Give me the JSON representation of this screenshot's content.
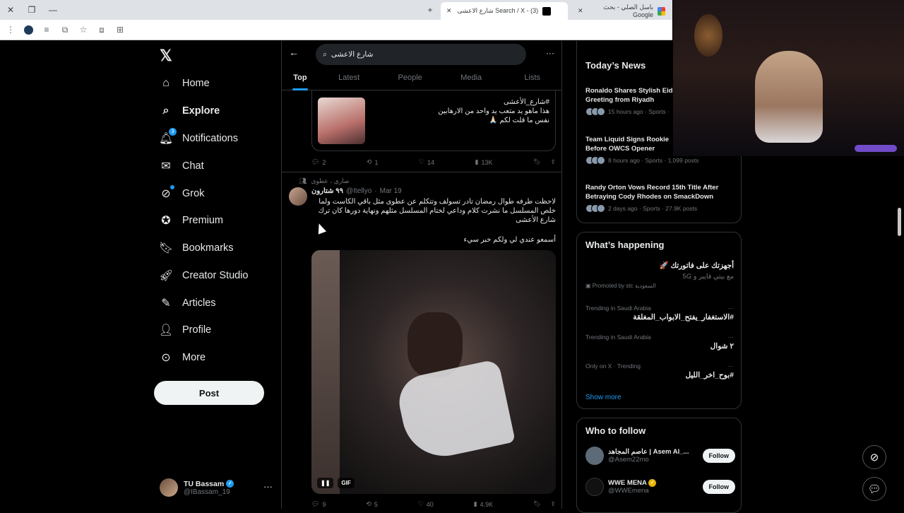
{
  "browser": {
    "tabs": [
      {
        "label": "Search / X - (3) شارع الاعشى"
      },
      {
        "label": "باسل الصلي - بحث Google"
      }
    ],
    "new_tab": "+"
  },
  "nav": {
    "items": [
      {
        "label": "Home",
        "icon": "home-icon"
      },
      {
        "label": "Explore",
        "icon": "search-icon"
      },
      {
        "label": "Notifications",
        "icon": "bell-icon",
        "badge": "3"
      },
      {
        "label": "Chat",
        "icon": "mail-icon"
      },
      {
        "label": "Grok",
        "icon": "grok-icon"
      },
      {
        "label": "Premium",
        "icon": "premium-icon"
      },
      {
        "label": "Bookmarks",
        "icon": "bookmark-icon"
      },
      {
        "label": "Creator Studio",
        "icon": "rocket-icon"
      },
      {
        "label": "Articles",
        "icon": "article-icon"
      },
      {
        "label": "Profile",
        "icon": "person-icon"
      },
      {
        "label": "More",
        "icon": "more-icon"
      }
    ],
    "post_label": "Post",
    "account": {
      "name": "TU Bassam",
      "handle": "@IBassam_19"
    }
  },
  "search": {
    "query": "شارع الاعشى",
    "tabs": [
      "Top",
      "Latest",
      "People",
      "Media",
      "Lists"
    ],
    "active_tab": "Top"
  },
  "tweet1": {
    "quote_lines": [
      "#شارع_الأعشى",
      "هذا ماهو يد متعب يد واحد من الارهابين",
      "نفس ما قلت لكم 🙏🏻"
    ],
    "replies": "2",
    "reposts": "1",
    "likes": "14",
    "views": "13K"
  },
  "tweet2": {
    "social_context": "صاري ، عطوى",
    "name": "٩٩ شتارون",
    "handle": "@Itellyo",
    "date": "Mar 19",
    "text": "لاحظت طرفه طوال رمضان تادر تسولف وتتكلم عن عطوى مثل باقي الكاست ولما خلص المسلسل ما نشرت كلام وداعي لختام المسلسل مثلهم ونهاية دورها كان ترك شارع الأعشى",
    "text2": "أسمعو عندي لي ولكم خبر سيء",
    "gif_label": "GIF",
    "replies": "9",
    "reposts": "5",
    "likes": "40",
    "views": "4.9K"
  },
  "news": {
    "title": "Today’s News",
    "items": [
      {
        "title": "Ronaldo Shares Stylish Eid\nGreeting from Riyadh",
        "meta": "15 hours ago · Sports ·"
      },
      {
        "title": "Team Liquid Signs Rookie\nBefore OWCS Opener",
        "meta": "8 hours ago · Sports · 1,099 posts"
      },
      {
        "title": "Randy Orton Vows Record 15th Title After\nBetraying Cody Rhodes on SmackDown",
        "meta": "2 days ago · Sports · 27.9K posts"
      }
    ]
  },
  "happening": {
    "title": "What’s happening",
    "promo": {
      "title": "أجهزتك على فاتورتك 🚀",
      "sub": "مع بيتي فايبر و 5G",
      "by": "Promoted by stc السعودية"
    },
    "trends": [
      {
        "context": "Trending in Saudi Arabia",
        "topic": "#الاستغفار_يفتح_الابواب_المغلقة"
      },
      {
        "context": "Trending in Saudi Arabia",
        "topic": "٢ شوال"
      },
      {
        "context": "Only on X · Trending",
        "topic": "#بوح_اخر_الليل"
      }
    ],
    "show_more": "Show more"
  },
  "who_to_follow": {
    "title": "Who to follow",
    "items": [
      {
        "name": "عاصم المجاهد | Asem Al_...",
        "handle": "@Asem22mo",
        "button": "Follow"
      },
      {
        "name": "WWE MENA",
        "handle": "@WWEmena",
        "button": "Follow"
      }
    ]
  }
}
